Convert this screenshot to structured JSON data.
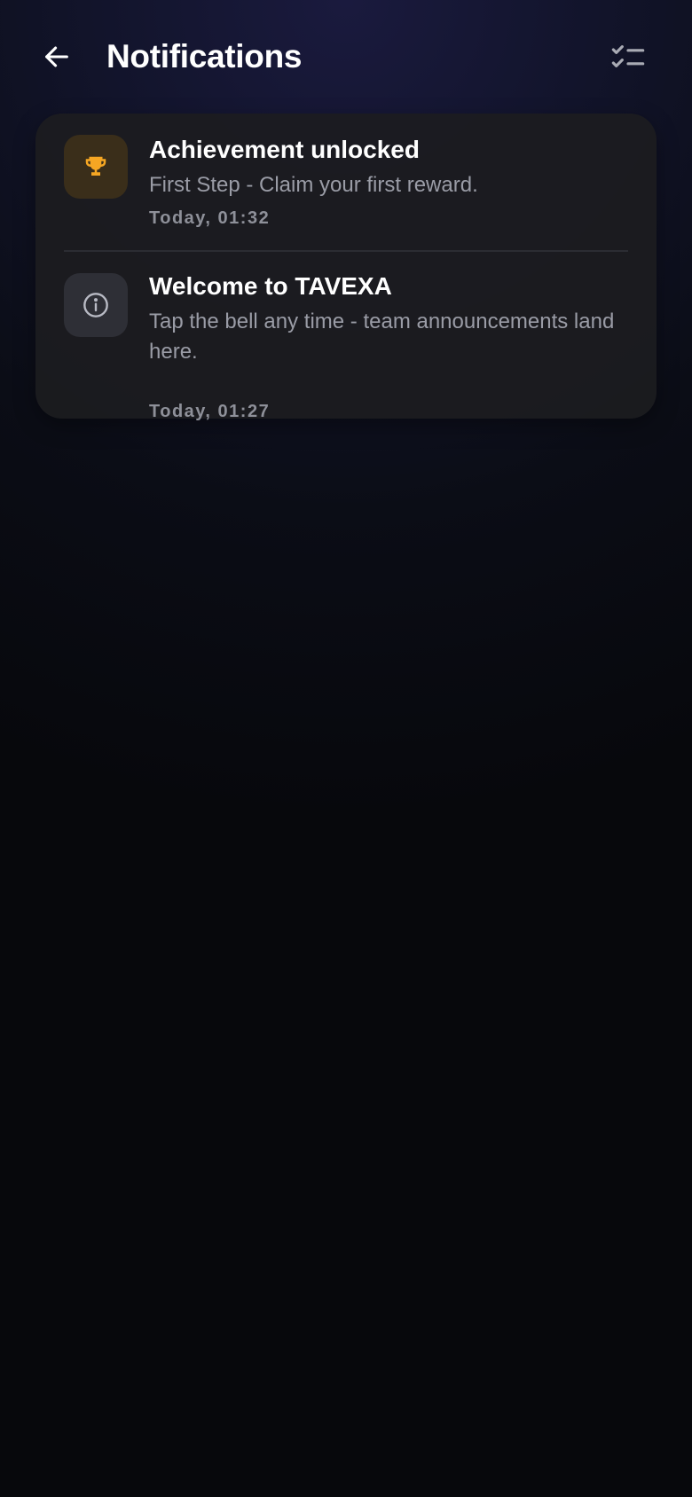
{
  "header": {
    "title": "Notifications",
    "back_icon": "arrow-left-icon",
    "action_icon": "checklist-icon"
  },
  "notifications": [
    {
      "icon": "trophy-icon",
      "icon_color": "#f5a623",
      "title": "Achievement unlocked",
      "body": "First Step - Claim your first reward.",
      "time": "Today, 01:32"
    },
    {
      "icon": "info-icon",
      "icon_color": "#b8bac4",
      "title": "Welcome to TAVEXA",
      "body": "Tap the bell any time - team announcements land here.",
      "time": "Today, 01:27"
    }
  ]
}
